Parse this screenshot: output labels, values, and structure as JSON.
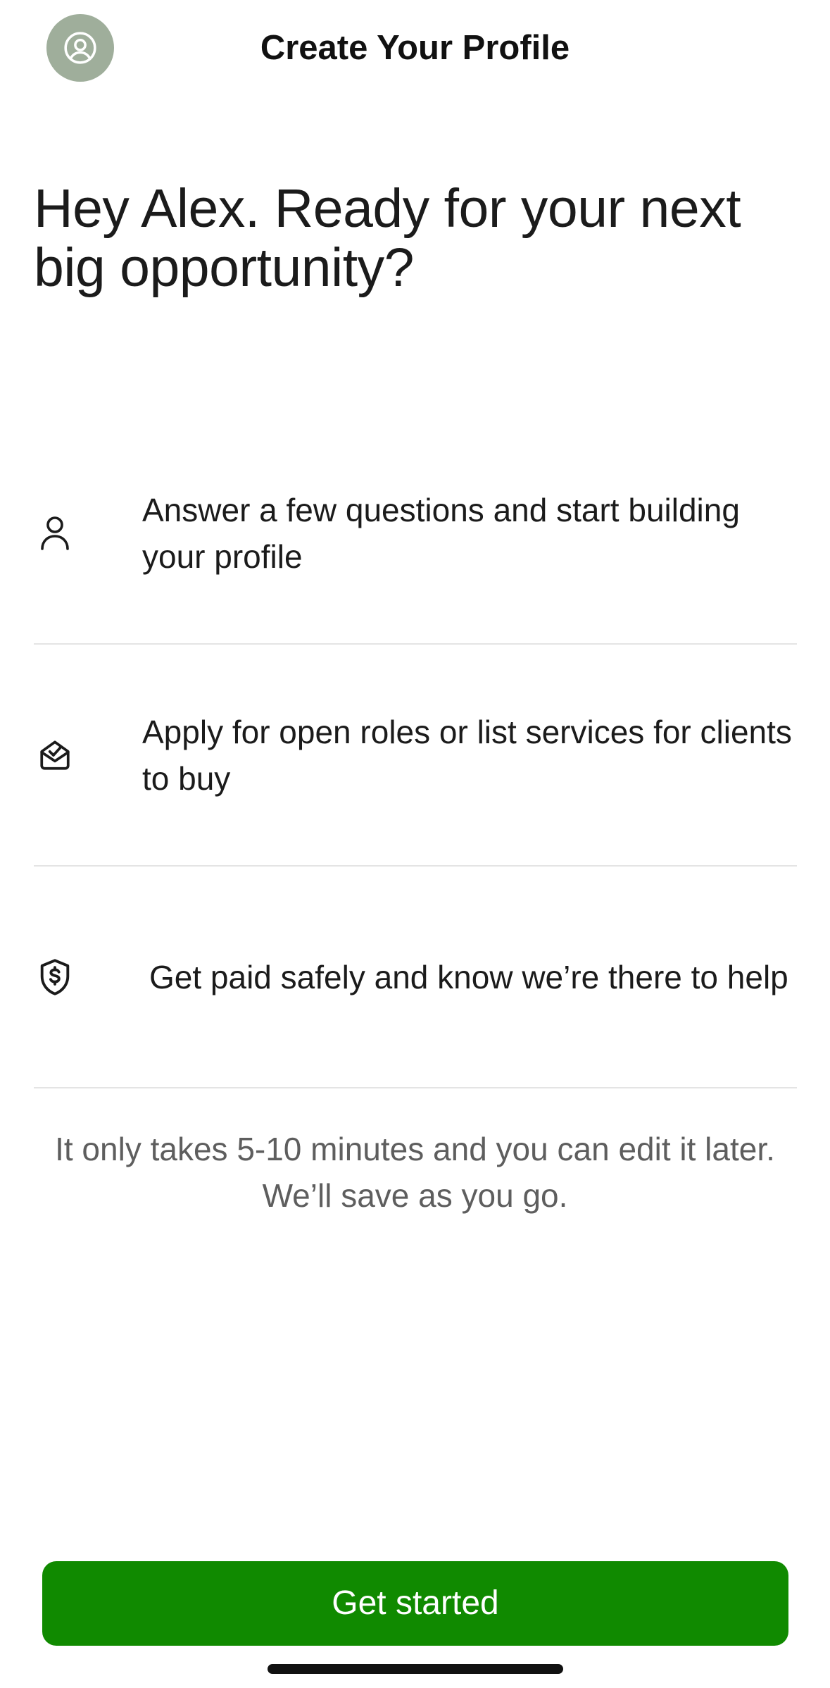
{
  "header": {
    "title": "Create Your Profile",
    "avatar_icon": "user-circle-icon"
  },
  "headline": "Hey Alex. Ready for your next big opportunity?",
  "features": [
    {
      "icon": "person-icon",
      "text": "Answer a few questions and start building your profile"
    },
    {
      "icon": "envelope-check-icon",
      "text": "Apply for open roles or list services for clients to buy"
    },
    {
      "icon": "shield-dollar-icon",
      "text": "Get paid safely and know we’re there to help"
    }
  ],
  "note": "It only takes 5-10 minutes and you can edit it later. We’ll save as you go.",
  "cta": {
    "label": "Get started"
  },
  "colors": {
    "primary": "#108a00",
    "avatar_bg": "#9fae9b",
    "divider": "#e4e4e4",
    "muted_text": "#5e5e5e"
  }
}
